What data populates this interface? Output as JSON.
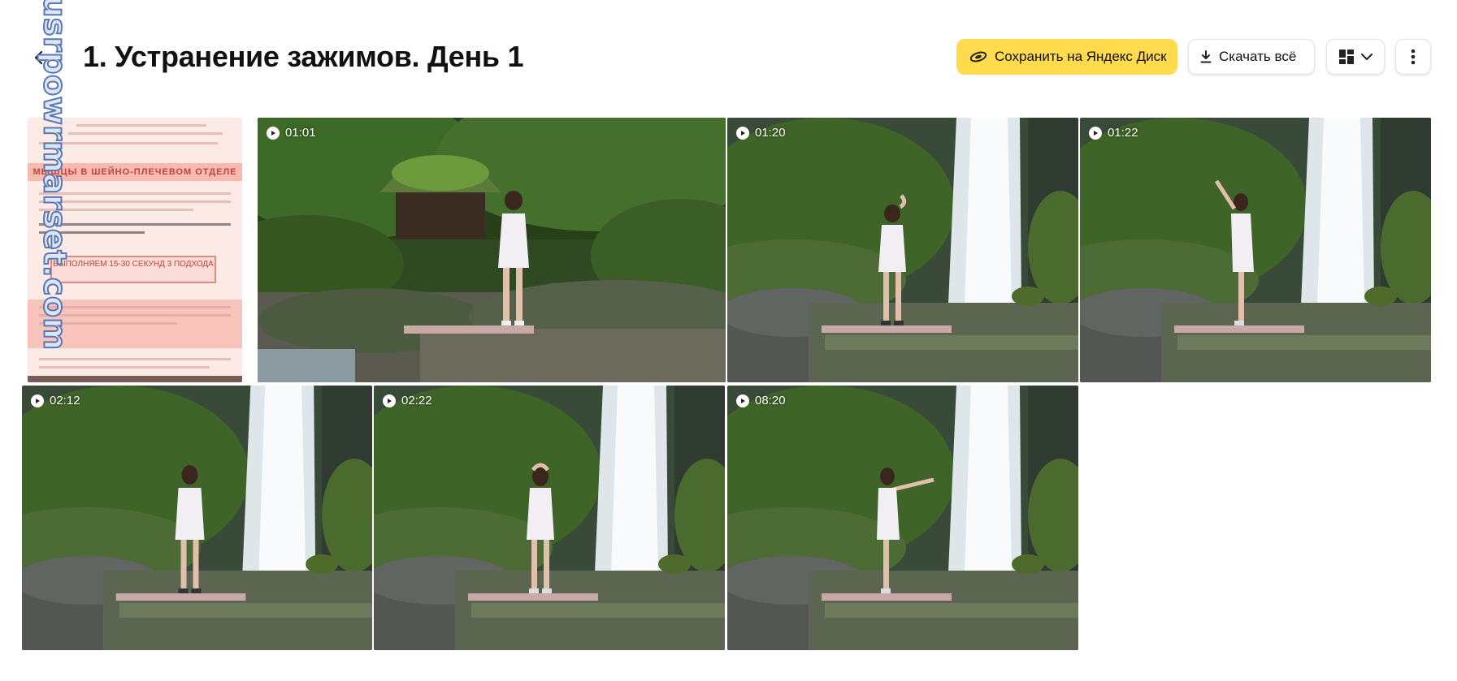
{
  "header": {
    "title": "1. Устранение зажимов. День 1",
    "back_icon": "arrow-left-icon",
    "watermark": "usrpowrmarset.com"
  },
  "toolbar": {
    "save_label": "Сохранить на Яндекс Диск",
    "save_icon": "yandex-disk-icon",
    "download_label": "Скачать всё",
    "download_icon": "download-icon",
    "view_icon": "grid-view-icon",
    "view_dropdown_icon": "chevron-down-icon",
    "more_icon": "more-vertical-icon"
  },
  "document_preview": {
    "heading": "МЫШЦЫ В ШЕЙНО-ПЛЕЧЕВОМ ОТДЕЛЕ",
    "box_text": "ВЫПОЛНЯЕМ 15-30 СЕКУНД 3 ПОДХОДА"
  },
  "videos": [
    {
      "duration": "01:01"
    },
    {
      "duration": "01:20"
    },
    {
      "duration": "01:22"
    },
    {
      "duration": "02:12"
    },
    {
      "duration": "02:22"
    },
    {
      "duration": "08:20"
    }
  ],
  "colors": {
    "accent": "#ffdb4d",
    "page_bg": "#ffffff",
    "text": "#111111"
  }
}
